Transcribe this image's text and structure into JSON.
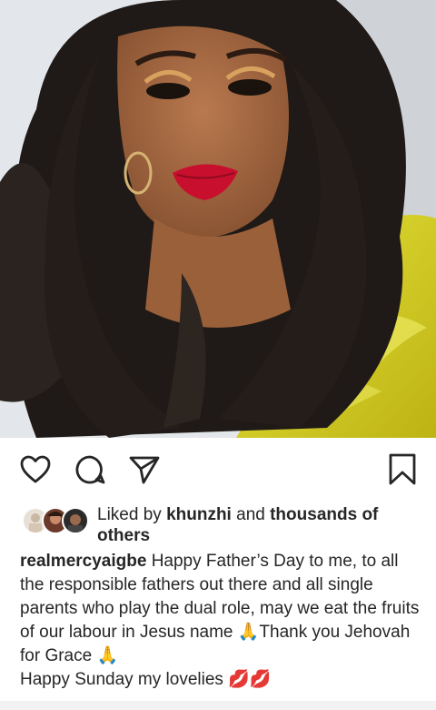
{
  "post": {
    "image_alt": "Selfie of a woman with long curly dark hair, red lipstick and a yellow ruffled outfit",
    "likes": {
      "prefix": "Liked by",
      "user": "khunzhi",
      "and": "and",
      "others_bold": "thousands of others"
    },
    "caption": {
      "username": "realmercyaigbe",
      "text_1": "Happy Father’s Day to me, to all the responsible fathers out there and all single parents who play the dual role, may we eat the fruits of our labour in Jesus name",
      "emoji_1": "🙏",
      "text_2": "Thank you Jehovah for Grace",
      "emoji_2": "🙏",
      "text_3": "Happy Sunday my lovelies",
      "emoji_3": "💋💋"
    }
  },
  "icons": {
    "like": "heart-outline-icon",
    "comment": "comment-bubble-icon",
    "share": "paper-plane-icon",
    "save": "bookmark-icon"
  },
  "colors": {
    "text": "#262626",
    "icon": "#262626",
    "lips": "#c8102e",
    "outfit": "#d9d321"
  }
}
